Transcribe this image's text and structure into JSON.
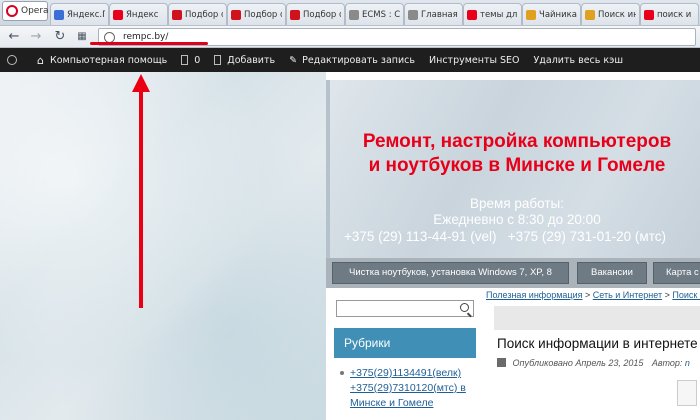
{
  "browser": {
    "opera_label": "Opera",
    "tabs": [
      {
        "label": "Яндекс.По",
        "fav_color": "#3a6fd8"
      },
      {
        "label": "Яндекс",
        "fav_color": "#e8001a"
      },
      {
        "label": "Подбор с",
        "fav_color": "#d0121c"
      },
      {
        "label": "Подбор с",
        "fav_color": "#d0121c"
      },
      {
        "label": "Подбор с",
        "fav_color": "#d0121c"
      },
      {
        "label": "ECMS : Cr",
        "fav_color": "#8a8a8a"
      },
      {
        "label": "Главная",
        "fav_color": "#8a8a8a"
      },
      {
        "label": "темы для",
        "fav_color": "#e8001a"
      },
      {
        "label": "Чайника",
        "fav_color": "#e0a020"
      },
      {
        "label": "Поиск ин",
        "fav_color": "#e0a020"
      },
      {
        "label": "поиск и",
        "fav_color": "#e8001a"
      }
    ],
    "url": "rempc.by/"
  },
  "adminbar": {
    "site_name": "Компьютерная помощь",
    "comments_count": "0",
    "add": "Добавить",
    "edit": "Редактировать запись",
    "seo": "Инструменты SEO",
    "cache": "Удалить весь кэш"
  },
  "header": {
    "title_line1": "Ремонт, настройка компьютеров",
    "title_line2": "и ноутбуков в Минске и Гомеле",
    "hours_heading": "Время работы:",
    "hours": "Ежедневно с 8:30 до 20:00",
    "phones": "+375 (29) 113-44-91 (vel)   +375 (29) 731-01-20 (мтс)"
  },
  "menu": {
    "item1": "Чистка ноутбуков, установка Windows 7, XP, 8",
    "item2": "Вакансии",
    "item3": "Карта с"
  },
  "breadcrumbs": {
    "c1": "Полезная информация",
    "sep": " > ",
    "c2": "Сеть и Интернет",
    "c3": "Поиск ин"
  },
  "sidebar": {
    "heading": "Рубрики",
    "link_lines": [
      "+375(29)1134491(велк)",
      "+375(29)7310120(мтс) в",
      "Минске и Гомеле"
    ]
  },
  "post": {
    "title": "Поиск информации в интернете",
    "meta_prefix": "Опубликовано",
    "date": "Апрель 23, 2015",
    "author_label": "Автор:",
    "author": "n"
  }
}
